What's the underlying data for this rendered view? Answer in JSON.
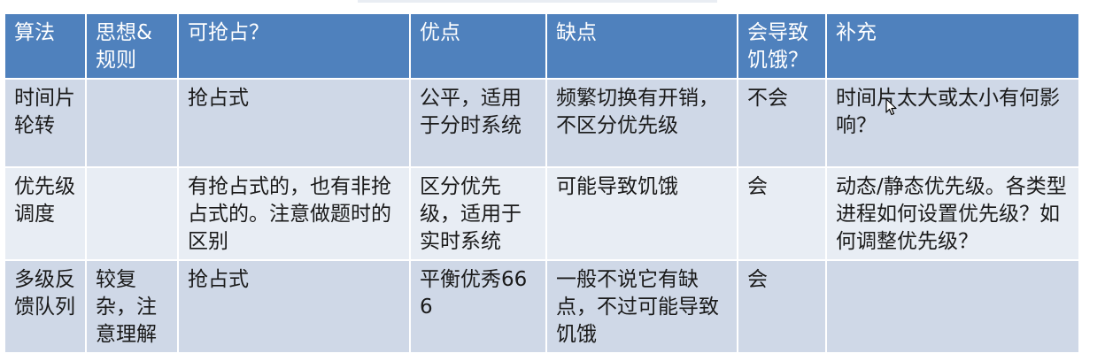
{
  "table": {
    "headers": [
      "算法",
      "思想&规则",
      "可抢占？",
      "优点",
      "缺点",
      "会导致饥饿？",
      "补充"
    ],
    "rows": [
      [
        "时间片轮转",
        "",
        "抢占式",
        "公平，适用于分时系统",
        "频繁切换有开销，不区分优先级",
        "不会",
        "时间片太大或太小有何影响？"
      ],
      [
        "优先级调度",
        "",
        "有抢占式的，也有非抢占式的。注意做题时的区别",
        "区分优先级，适用于实时系统",
        "可能导致饥饿",
        "会",
        "动态/静态优先级。各类型进程如何设置优先级？如何调整优先级？"
      ],
      [
        "多级反馈队列",
        "较复杂，注意理解",
        "抢占式",
        "平衡优秀666",
        "一般不说它有缺点，不过可能导致饥饿",
        "会",
        ""
      ]
    ]
  },
  "colors": {
    "header_bg": "#4f81bd",
    "row_odd_bg": "#cfd8e7",
    "row_even_bg": "#e8edf4",
    "header_text": "#ffffff"
  },
  "cursor": {
    "icon": "arrow-cursor-icon"
  }
}
